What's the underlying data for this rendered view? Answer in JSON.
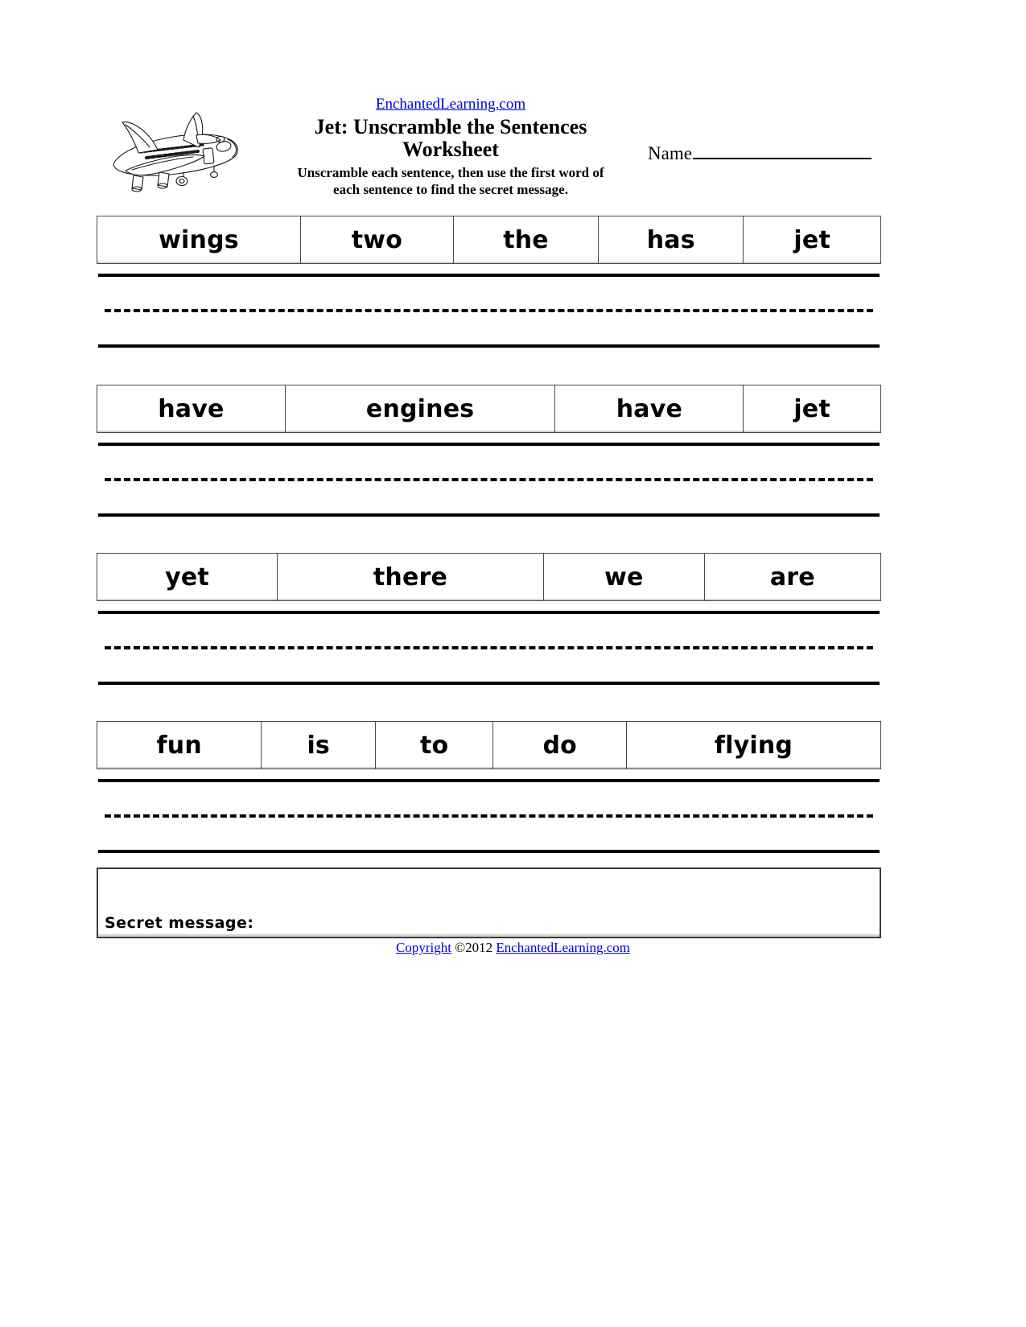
{
  "header": {
    "site_link": "EnchantedLearning.com",
    "title": "Jet: Unscramble the Sentences Worksheet",
    "title_line1": "Jet: Unscramble the Sentences",
    "title_line2": "Worksheet",
    "instructions_line1": "Unscramble each sentence, then use the first word of",
    "instructions_line2": "each sentence to find the secret message.",
    "name_label": "Name",
    "illustration": "jet-airplane-line-art"
  },
  "rows": [
    {
      "cells": [
        {
          "word": "wings",
          "flex": 26
        },
        {
          "word": "two",
          "flex": 19.5
        },
        {
          "word": "the",
          "flex": 18.5
        },
        {
          "word": "has",
          "flex": 18.5
        },
        {
          "word": "jet",
          "flex": 17.5
        }
      ]
    },
    {
      "cells": [
        {
          "word": "have",
          "flex": 24
        },
        {
          "word": "engines",
          "flex": 34.5
        },
        {
          "word": "have",
          "flex": 24
        },
        {
          "word": "jet",
          "flex": 17.5
        }
      ]
    },
    {
      "cells": [
        {
          "word": "yet",
          "flex": 23
        },
        {
          "word": "there",
          "flex": 34
        },
        {
          "word": "we",
          "flex": 20.5
        },
        {
          "word": "are",
          "flex": 22.5
        }
      ]
    },
    {
      "cells": [
        {
          "word": "fun",
          "flex": 21
        },
        {
          "word": "is",
          "flex": 14.5
        },
        {
          "word": "to",
          "flex": 15
        },
        {
          "word": "do",
          "flex": 17
        },
        {
          "word": "flying",
          "flex": 32.5
        }
      ]
    }
  ],
  "secret": {
    "label": "Secret message:"
  },
  "footer": {
    "copyright_word": "Copyright",
    "copyright_mid": " ©2012 ",
    "site": "EnchantedLearning.com"
  },
  "colors": {
    "link": "#0000dd",
    "text": "#000000",
    "border": "#4a4a4a",
    "page_bg": "#ffffff"
  }
}
